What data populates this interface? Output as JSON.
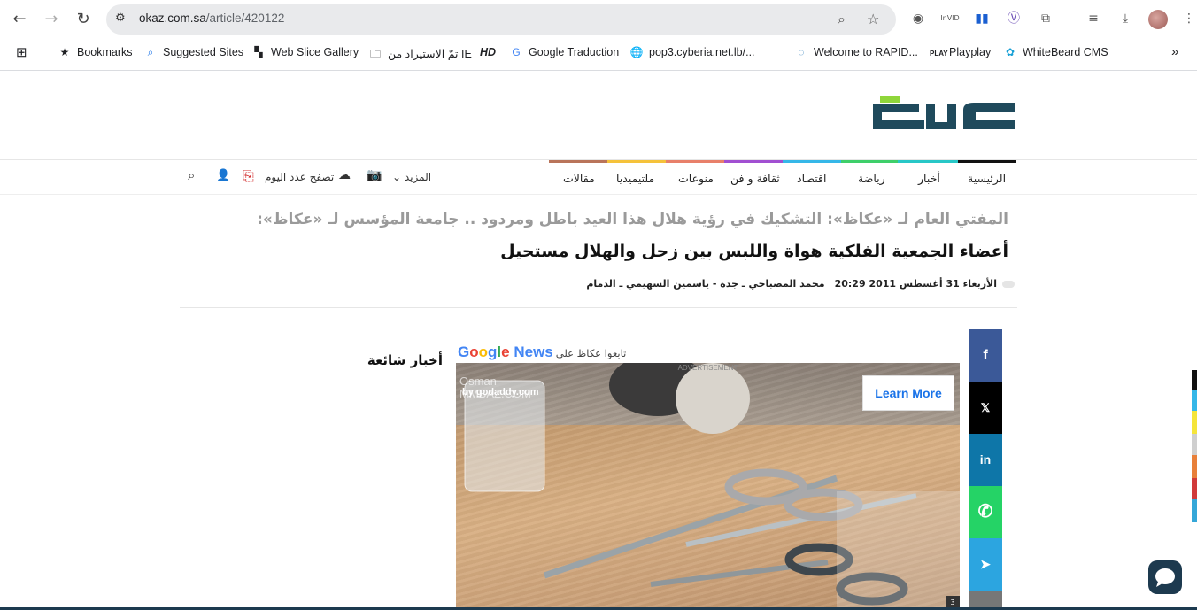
{
  "browser": {
    "url_host": "okaz.com.sa",
    "url_path": "/article/420122",
    "bookmarks": [
      {
        "label": "Bookmarks",
        "icon": "star-icon"
      },
      {
        "label": "Suggested Sites",
        "icon": "search-icon"
      },
      {
        "label": "Web Slice Gallery",
        "icon": "web-slice-icon"
      },
      {
        "label": "تمّ الاستيراد من IE",
        "icon": "folder-icon"
      },
      {
        "label": "HD",
        "icon": "hd-icon"
      },
      {
        "label": "Google Traduction",
        "icon": "translate-icon"
      },
      {
        "label": "pop3.cyberia.net.lb/...",
        "icon": "globe-icon"
      },
      {
        "label": "Welcome to RAPID...",
        "icon": "rapid-icon"
      },
      {
        "label": "Playplay",
        "icon": "playplay-icon"
      },
      {
        "label": "WhiteBeard CMS",
        "icon": "whitebeard-icon"
      }
    ]
  },
  "site": {
    "logo_text": "عكاظ",
    "nav": [
      {
        "label": "الرئيسية",
        "color": "#111111"
      },
      {
        "label": "أخبار",
        "color": "#27c7c7"
      },
      {
        "label": "رياضة",
        "color": "#3ecf6a"
      },
      {
        "label": "اقتصاد",
        "color": "#35b7e8"
      },
      {
        "label": "ثقافة و فن",
        "color": "#a14fd1"
      },
      {
        "label": "منوعات",
        "color": "#e8806a"
      },
      {
        "label": "ملتيميديا",
        "color": "#f5c23a"
      },
      {
        "label": "مقالات",
        "color": "#b9745a"
      }
    ],
    "more_label": "المزيد",
    "today_issue_label": "تصفح عدد اليوم"
  },
  "article": {
    "pre_headline": "المفتي العام لـ «عكاظ»: التشكيك في رؤية هلال هذا العيد باطل ومردود .. جامعة المؤسس لـ «عكاظ»:",
    "headline": "أعضاء الجمعية الفلكية هواة واللبس بين زحل والهلال مستحيل",
    "date": "الأربعاء 31 أغسطس 2011 20:29",
    "authors": "محمد المصباحي ـ جدة - ياسمين السهيمي ـ الدمام"
  },
  "follow": {
    "prefix": "تابعوا عكاظ على",
    "google": "Google",
    "news": "News"
  },
  "sidebar": {
    "popular_title": "أخبار شائعة"
  },
  "ad": {
    "label": "ADVERTISEMENT",
    "watermark_1": "Osman",
    "watermark_2": "MMBAZ.COM",
    "by": "by godaddy.com",
    "cta": "Learn More",
    "counter": "3"
  },
  "share": [
    {
      "name": "facebook",
      "glyph": "f",
      "color": "#3b5998"
    },
    {
      "name": "x",
      "glyph": "𝕏",
      "color": "#000000"
    },
    {
      "name": "linkedin",
      "glyph": "in",
      "color": "#0e76a8"
    },
    {
      "name": "whatsapp",
      "glyph": "✆",
      "color": "#25d366"
    },
    {
      "name": "telegram",
      "glyph": "➤",
      "color": "#2ca5e0"
    },
    {
      "name": "more",
      "glyph": "",
      "color": "#777777"
    }
  ]
}
